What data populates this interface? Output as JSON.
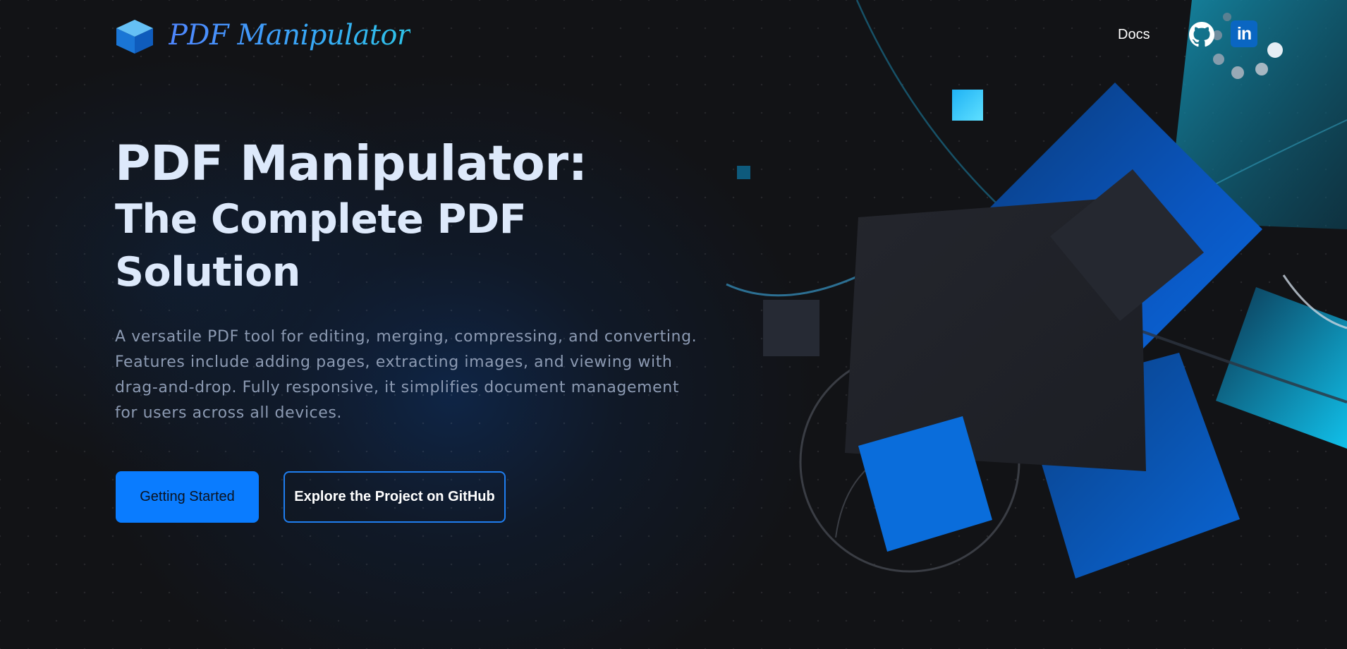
{
  "header": {
    "logo_text": "PDF Manipulator",
    "nav": {
      "docs_label": "Docs",
      "github_icon": "github-icon",
      "linkedin_label": "in"
    }
  },
  "hero": {
    "title_line1": "PDF Manipulator:",
    "title_line2": "The Complete PDF",
    "title_line3": "Solution",
    "description": "A versatile PDF tool for editing, merging, compressing, and converting. Features include adding pages, extracting images, and viewing with drag-and-drop. Fully responsive, it simplifies document management for users across all devices.",
    "primary_button": "Getting Started",
    "secondary_button": "Explore the Project on GitHub"
  },
  "colors": {
    "background": "#121316",
    "accent": "#0a7cff",
    "title": "#dde9fb",
    "body_text": "#8c9ab2",
    "linkedin": "#0a66c2"
  }
}
